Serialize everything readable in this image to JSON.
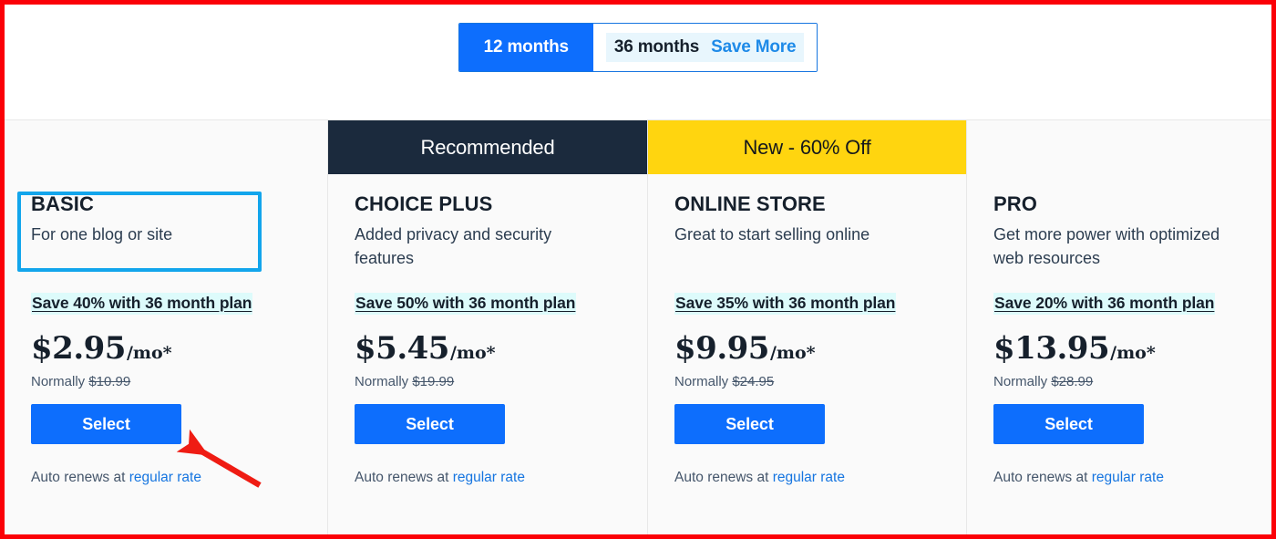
{
  "toggle": {
    "option_12_label": "12 months",
    "option_36_label": "36 months",
    "save_more_label": "Save More",
    "active_option": "12 months",
    "active_bg": "#0d6efd",
    "inactive_bg": "#e8f6fd",
    "save_more_color": "#1e8ae8"
  },
  "annotations": {
    "frame_color": "#fb0007",
    "basic_box_color": "#12a5ec",
    "arrow_color": "#ef1c13"
  },
  "plans": [
    {
      "banner_label": "",
      "banner_style": "none",
      "title": "BASIC",
      "tagline": "For one blog or site",
      "savings": "Save 40% with 36 month plan",
      "price_amount": "$2.95",
      "price_unit": "/mo*",
      "normally_prefix": "Normally ",
      "normally_price": "$10.99",
      "select_label": "Select",
      "autorenew_prefix": "Auto renews at ",
      "autorenew_link": "regular rate"
    },
    {
      "banner_label": "Recommended",
      "banner_style": "dark",
      "banner_bg": "#1b2a3d",
      "title": "CHOICE PLUS",
      "tagline": "Added privacy and security features",
      "savings": "Save 50% with 36 month plan",
      "price_amount": "$5.45",
      "price_unit": "/mo*",
      "normally_prefix": "Normally ",
      "normally_price": "$19.99",
      "select_label": "Select",
      "autorenew_prefix": "Auto renews at ",
      "autorenew_link": "regular rate"
    },
    {
      "banner_label": "New - 60% Off",
      "banner_style": "yellow",
      "banner_bg": "#ffd50f",
      "title": "ONLINE STORE",
      "tagline": "Great to start selling online",
      "savings": "Save 35% with 36 month plan",
      "price_amount": "$9.95",
      "price_unit": "/mo*",
      "normally_prefix": "Normally ",
      "normally_price": "$24.95",
      "select_label": "Select",
      "autorenew_prefix": "Auto renews at ",
      "autorenew_link": "regular rate"
    },
    {
      "banner_label": "",
      "banner_style": "none",
      "title": "PRO",
      "tagline": "Get more power with optimized web resources",
      "savings": "Save 20% with 36 month plan",
      "price_amount": "$13.95",
      "price_unit": "/mo*",
      "normally_prefix": "Normally ",
      "normally_price": "$28.99",
      "select_label": "Select",
      "autorenew_prefix": "Auto renews at ",
      "autorenew_link": "regular rate"
    }
  ]
}
